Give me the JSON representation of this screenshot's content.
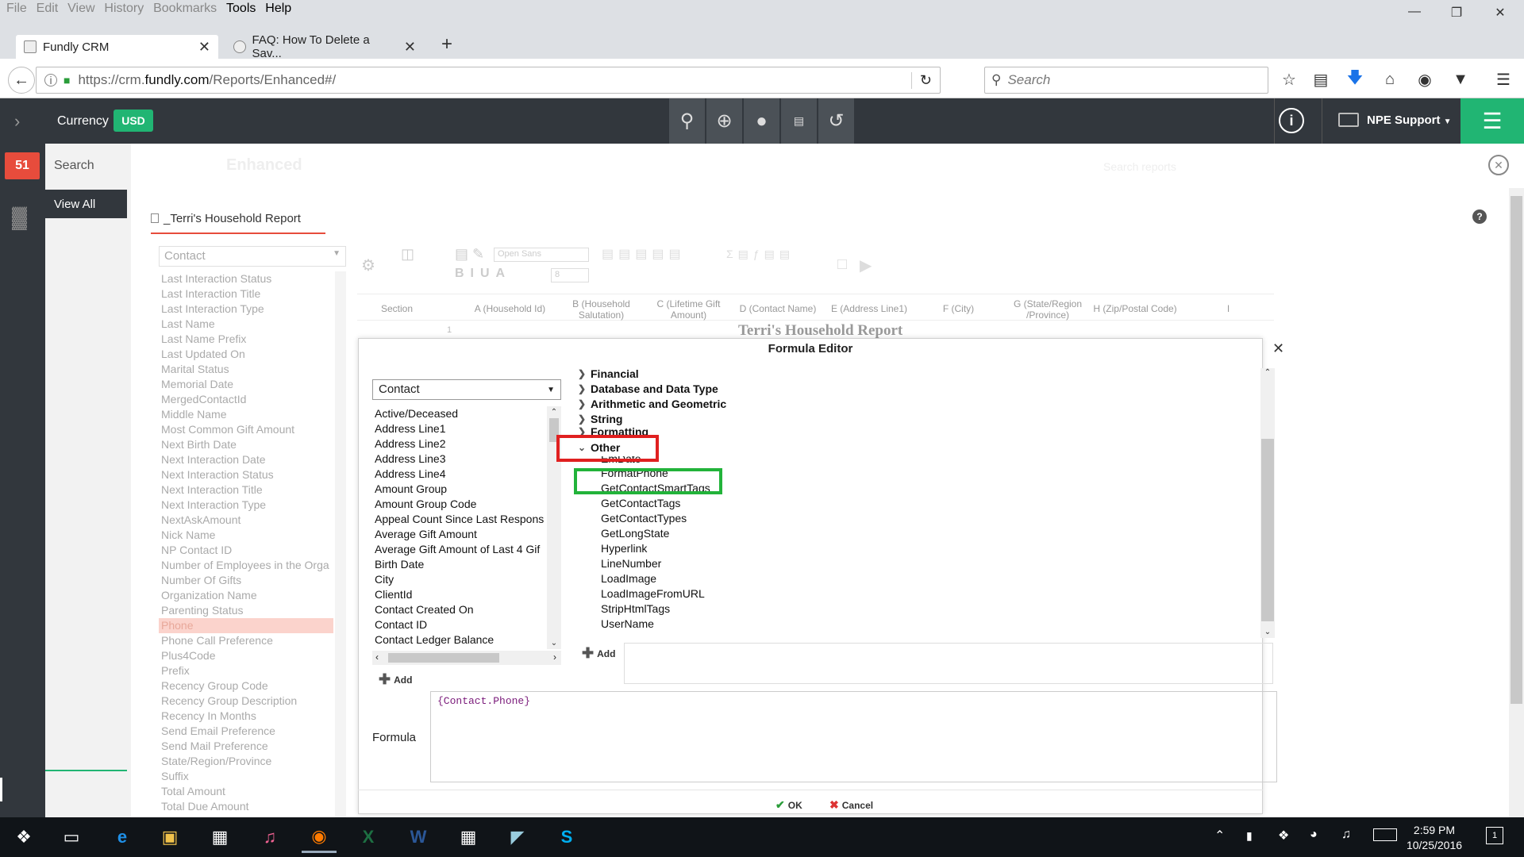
{
  "browser": {
    "menus": [
      "File",
      "Edit",
      "View",
      "History",
      "Bookmarks",
      "Tools",
      "Help"
    ],
    "tabs": [
      {
        "title": "Fundly CRM"
      },
      {
        "title": "FAQ: How To Delete a Sav..."
      }
    ],
    "url_prefix": "https://crm.",
    "url_domain": "fundly.com",
    "url_path": "/Reports/Enhanced#/",
    "search_placeholder": "Search"
  },
  "header": {
    "currency_label": "Currency",
    "currency_value": "USD",
    "user_label": "NPE Support",
    "notification_count": "51"
  },
  "left_panel": {
    "search_label": "Search",
    "view_all_label": "View All"
  },
  "report": {
    "tab_title": "_Terri's Household Report",
    "section_label": "Contact",
    "background_title": "Enhanced",
    "search_reports_placeholder": "Search reports",
    "grid_title": "Terri's Household Report",
    "font_name": "Open Sans",
    "font_size": "8",
    "row_number": "1",
    "columns": [
      "Section",
      "A (Household Id)",
      "B (Household Salutation)",
      "C (Lifetime Gift Amount)",
      "D (Contact Name)",
      "E (Address Line1)",
      "F (City)",
      "G (State/Region /Province)",
      "H (Zip/Postal Code)",
      "I"
    ],
    "fields": [
      "Last Interaction Status",
      "Last Interaction Title",
      "Last Interaction Type",
      "Last Name",
      "Last Name Prefix",
      "Last Updated On",
      "Marital Status",
      "Memorial Date",
      "MergedContactId",
      "Middle Name",
      "Most Common Gift Amount",
      "Next Birth Date",
      "Next Interaction Date",
      "Next Interaction Status",
      "Next Interaction Title",
      "Next Interaction Type",
      "NextAskAmount",
      "Nick Name",
      "NP Contact ID",
      "Number of Employees in the Orga",
      "Number Of Gifts",
      "Organization Name",
      "Parenting Status",
      "Phone",
      "Phone Call Preference",
      "Plus4Code",
      "Prefix",
      "Recency Group Code",
      "Recency Group Description",
      "Recency In Months",
      "Send Email Preference",
      "Send Mail Preference",
      "State/Region/Province",
      "Suffix",
      "Total Amount",
      "Total Due Amount"
    ],
    "selected_field": "Phone"
  },
  "formula_editor": {
    "title": "Formula Editor",
    "source_select": "Contact",
    "source_fields": [
      "Active/Deceased",
      "Address Line1",
      "Address Line2",
      "Address Line3",
      "Address Line4",
      "Amount Group",
      "Amount Group Code",
      "Appeal Count Since Last Respons",
      "Average Gift Amount",
      "Average Gift Amount of Last 4 Gif",
      "Birth Date",
      "City",
      "ClientId",
      "Contact Created On",
      "Contact ID",
      "Contact Ledger Balance"
    ],
    "categories": [
      "Financial",
      "Database and Data Type",
      "Arithmetic and Geometric",
      "String",
      "Formatting"
    ],
    "expanded_category": "Other",
    "functions": [
      "EmDate",
      "FormatPhone",
      "GetContactSmartTags",
      "GetContactTags",
      "GetContactTypes",
      "GetLongState",
      "Hyperlink",
      "LineNumber",
      "LoadImage",
      "LoadImageFromURL",
      "StripHtmlTags",
      "UserName"
    ],
    "add_label": "Add",
    "formula_label": "Formula",
    "formula_value": "{Contact.Phone}",
    "ok_label": "OK",
    "cancel_label": "Cancel",
    "highlight_colors": {
      "category": "#e02020",
      "function": "#22b33a"
    }
  },
  "taskbar": {
    "time": "2:59 PM",
    "date": "10/25/2016",
    "notification_count": "1"
  }
}
